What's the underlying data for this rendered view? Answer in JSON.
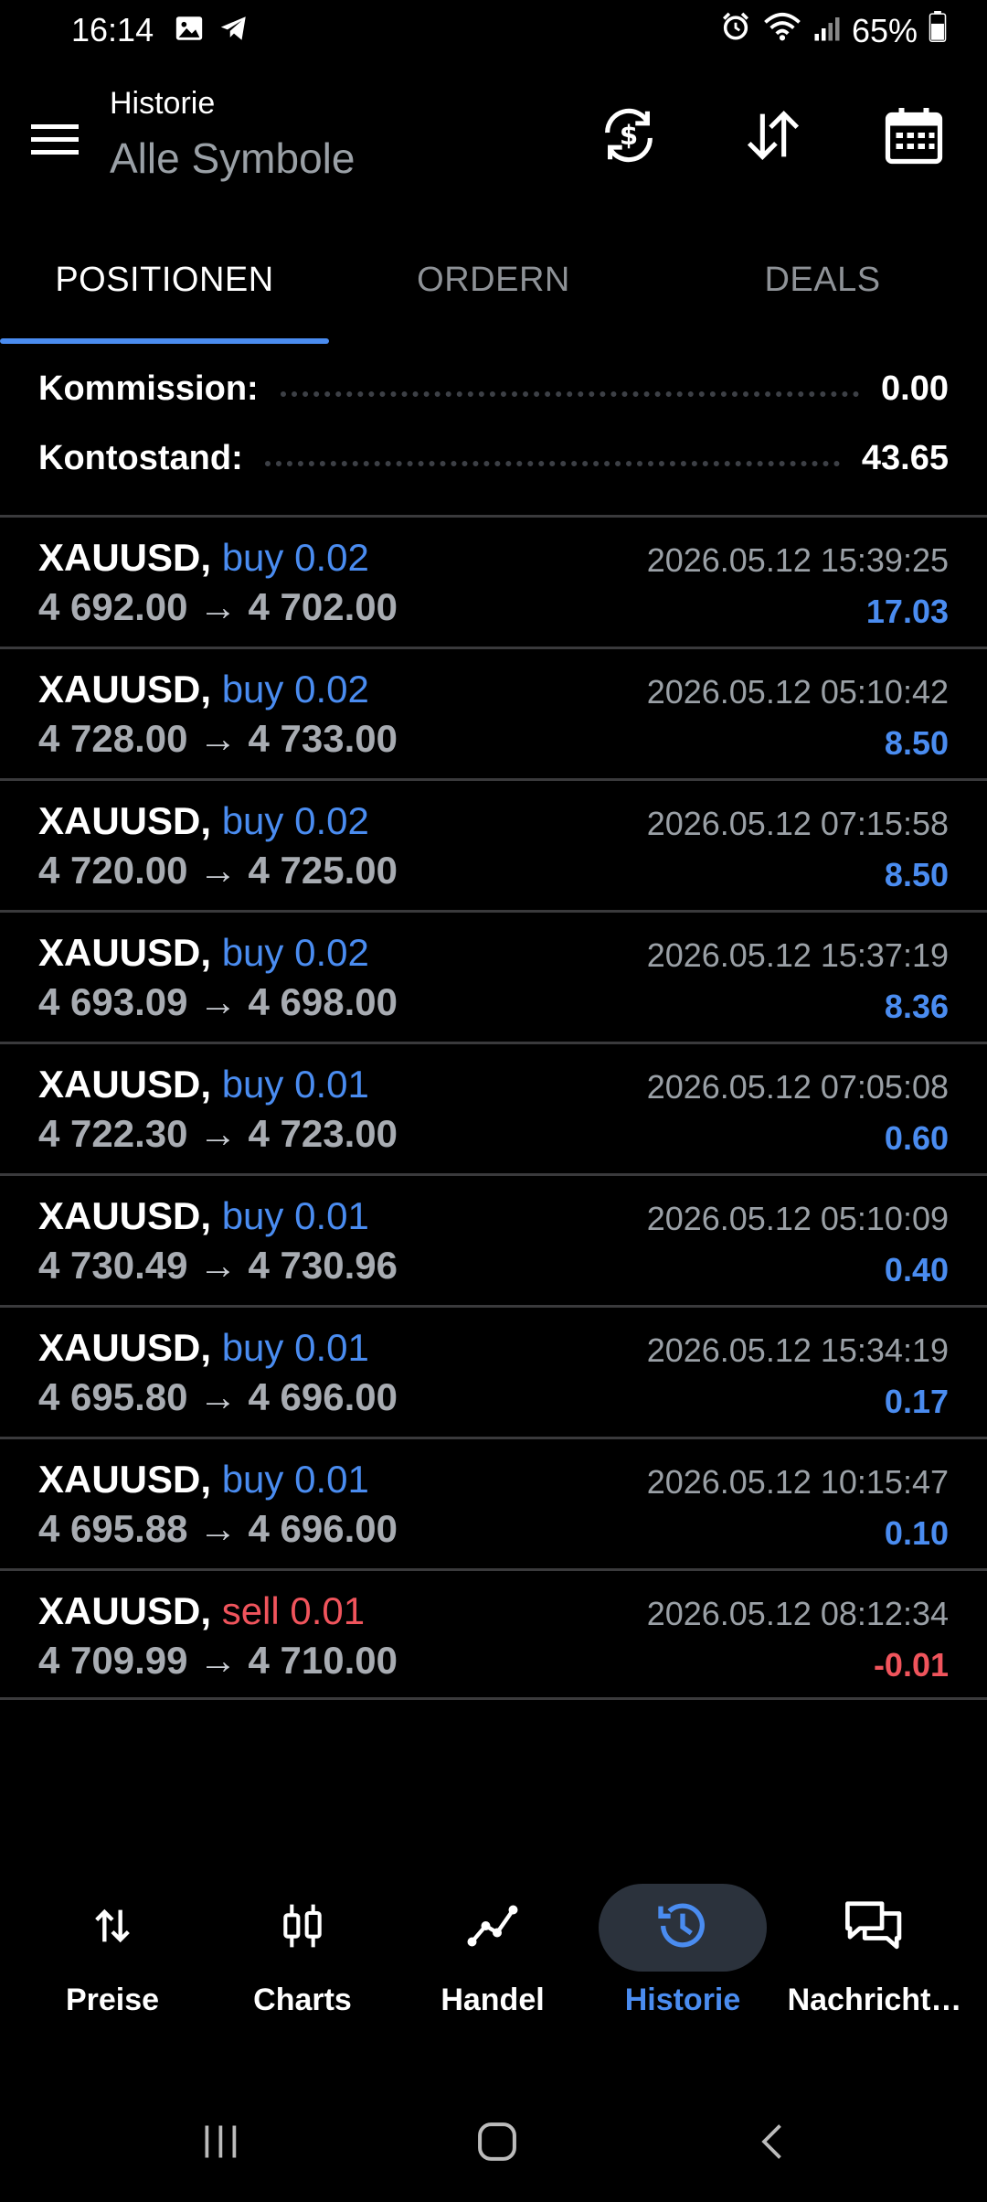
{
  "status_bar": {
    "time": "16:14",
    "battery": "65%",
    "left_icons": [
      "gallery-icon",
      "telegram-icon"
    ],
    "right_icons": [
      "alarm-icon",
      "wifi-icon",
      "signal-icon",
      "battery-icon"
    ]
  },
  "header": {
    "title": "Historie",
    "subtitle": "Alle Symbole",
    "actions": [
      "currency-exchange-icon",
      "sort-icon",
      "calendar-icon"
    ]
  },
  "tabs": [
    {
      "label": "POSITIONEN",
      "active": true
    },
    {
      "label": "ORDERN",
      "active": false
    },
    {
      "label": "DEALS",
      "active": false
    }
  ],
  "summary": {
    "commission_label": "Kommission:",
    "commission_value": "0.00",
    "balance_label": "Kontostand:",
    "balance_value": "43.65"
  },
  "positions": [
    {
      "symbol": "XAUUSD,",
      "direction": "buy",
      "volume": "0.02",
      "open": "4 692.00",
      "close": "4 702.00",
      "time": "2026.05.12 15:39:25",
      "profit": "17.03"
    },
    {
      "symbol": "XAUUSD,",
      "direction": "buy",
      "volume": "0.02",
      "open": "4 728.00",
      "close": "4 733.00",
      "time": "2026.05.12 05:10:42",
      "profit": "8.50"
    },
    {
      "symbol": "XAUUSD,",
      "direction": "buy",
      "volume": "0.02",
      "open": "4 720.00",
      "close": "4 725.00",
      "time": "2026.05.12 07:15:58",
      "profit": "8.50"
    },
    {
      "symbol": "XAUUSD,",
      "direction": "buy",
      "volume": "0.02",
      "open": "4 693.09",
      "close": "4 698.00",
      "time": "2026.05.12 15:37:19",
      "profit": "8.36"
    },
    {
      "symbol": "XAUUSD,",
      "direction": "buy",
      "volume": "0.01",
      "open": "4 722.30",
      "close": "4 723.00",
      "time": "2026.05.12 07:05:08",
      "profit": "0.60"
    },
    {
      "symbol": "XAUUSD,",
      "direction": "buy",
      "volume": "0.01",
      "open": "4 730.49",
      "close": "4 730.96",
      "time": "2026.05.12 05:10:09",
      "profit": "0.40"
    },
    {
      "symbol": "XAUUSD,",
      "direction": "buy",
      "volume": "0.01",
      "open": "4 695.80",
      "close": "4 696.00",
      "time": "2026.05.12 15:34:19",
      "profit": "0.17"
    },
    {
      "symbol": "XAUUSD,",
      "direction": "buy",
      "volume": "0.01",
      "open": "4 695.88",
      "close": "4 696.00",
      "time": "2026.05.12 10:15:47",
      "profit": "0.10"
    },
    {
      "symbol": "XAUUSD,",
      "direction": "sell",
      "volume": "0.01",
      "open": "4 709.99",
      "close": "4 710.00",
      "time": "2026.05.12 08:12:34",
      "profit": "-0.01"
    }
  ],
  "arrow": "→",
  "bottom_nav": [
    {
      "label": "Preise",
      "icon": "quotes-icon",
      "active": false
    },
    {
      "label": "Charts",
      "icon": "candlestick-icon",
      "active": false
    },
    {
      "label": "Handel",
      "icon": "trade-icon",
      "active": false
    },
    {
      "label": "Historie",
      "icon": "history-icon",
      "active": true
    },
    {
      "label": "Nachricht…",
      "icon": "messages-icon",
      "active": false
    }
  ],
  "colors": {
    "accent": "#4a8cf0",
    "loss": "#f0545c",
    "background": "#000000",
    "muted": "#9aa0a6"
  }
}
